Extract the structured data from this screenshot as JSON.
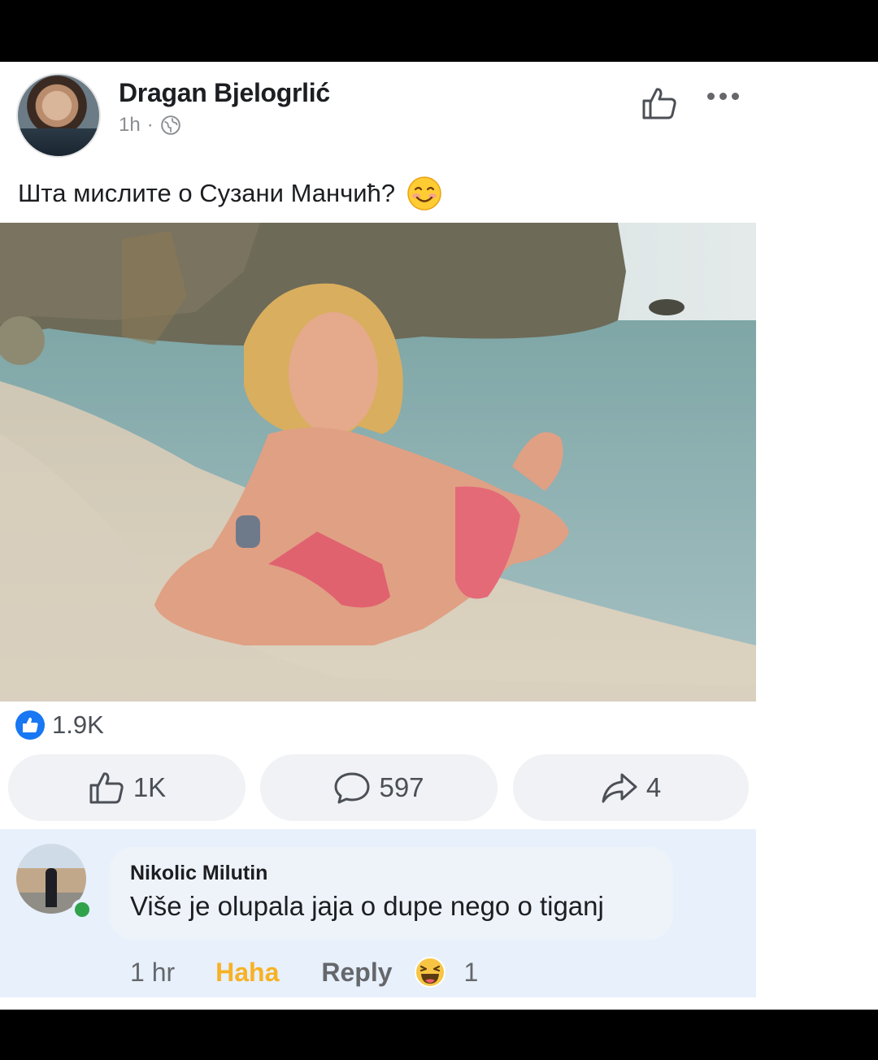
{
  "post": {
    "author": "Dragan Bjelogrlić",
    "time": "1h",
    "separator": "·",
    "caption": "Шта мислите о Сузани Манчић?",
    "reactions_count": "1.9K",
    "like_count": "1K",
    "comment_count": "597",
    "share_count": "4"
  },
  "comment": {
    "author": "Nikolic Milutin",
    "text": "Više je olupala jaja o dupe nego o tiganj",
    "time": "1 hr",
    "reaction_label": "Haha",
    "reply_label": "Reply",
    "reaction_count": "1"
  },
  "colors": {
    "like_blue": "#1877f2",
    "haha_yellow": "#f7b125",
    "online_green": "#31a24c",
    "comment_bg": "#e7f0fb",
    "pill_bg": "#f0f2f5"
  },
  "icons": [
    "globe-icon",
    "like-outline-icon",
    "more-icon",
    "smile-emoji-icon",
    "like-badge-icon",
    "comment-icon",
    "share-icon",
    "haha-emoji-icon"
  ]
}
